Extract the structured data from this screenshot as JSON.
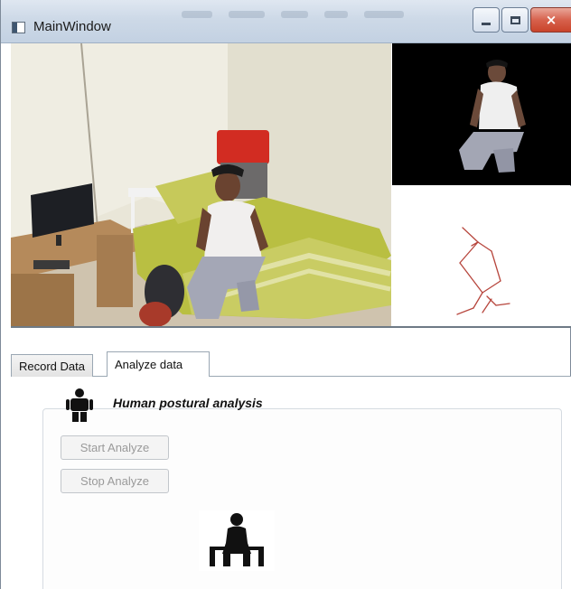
{
  "window": {
    "title": "MainWindow",
    "controls": {
      "minimize": "minimize",
      "maximize": "maximize",
      "close": "×"
    }
  },
  "tabs": [
    {
      "label": "Record Data",
      "selected": false
    },
    {
      "label": "Analyze data",
      "selected": true
    }
  ],
  "analysis": {
    "section_title": "Human postural analysis",
    "start_button": "Start Analyze",
    "stop_button": "Stop Analyze",
    "detected_posture_icon": "sitting-person-icon"
  },
  "colors": {
    "skeleton": "#b7463d",
    "depth_background": "#000000",
    "titlebar": "#cdd9e7",
    "close_button": "#c9432a"
  }
}
